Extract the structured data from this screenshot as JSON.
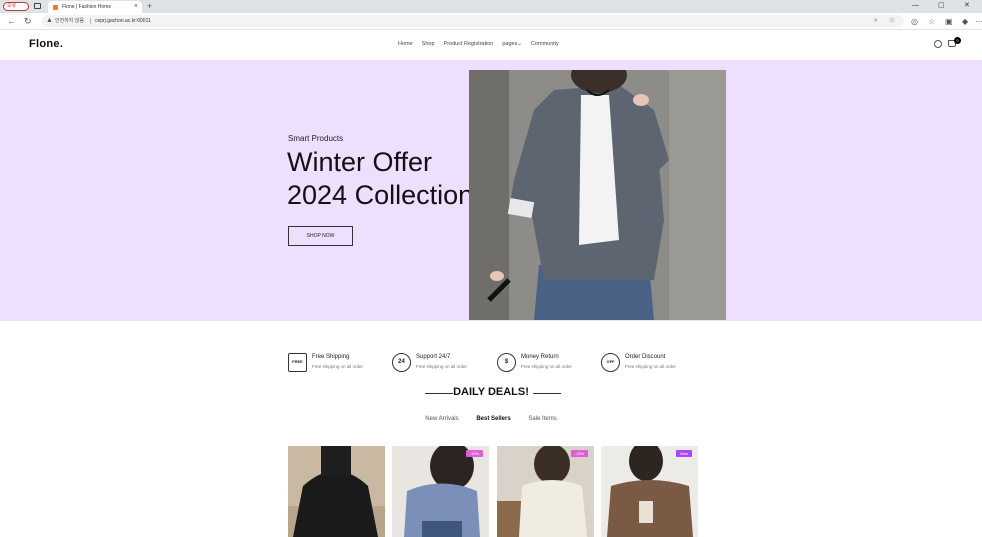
{
  "browser": {
    "profile_label": "오류",
    "tab_title": "Flone | Fashion Home",
    "tab_close": "×",
    "new_tab": "+",
    "security_warning": "안전하지 않음",
    "url": "ceprj.gachon.ac.kr:60011",
    "window_controls": [
      "—",
      "▢",
      "✕"
    ]
  },
  "site": {
    "logo": "Flone.",
    "nav": [
      "Home",
      "Shop",
      "Product Registration",
      "pages",
      "Community"
    ],
    "cart_count": "0"
  },
  "hero": {
    "subtitle": "Smart Products",
    "title_line1": "Winter Offer",
    "title_line2": "2024 Collection",
    "button_label": "SHOP NOW",
    "background_color": "#efdfff"
  },
  "features": [
    {
      "title": "Free Shipping",
      "desc": "Free shipping on all order",
      "icon": "truck-icon",
      "glyph": "FREE"
    },
    {
      "title": "Support 24/7",
      "desc": "Free shipping on all order",
      "icon": "support-24-icon",
      "glyph": "24"
    },
    {
      "title": "Money Return",
      "desc": "Free shipping on all order",
      "icon": "money-return-icon",
      "glyph": "$"
    },
    {
      "title": "Order Discount",
      "desc": "Free shipping on all order",
      "icon": "discount-icon",
      "glyph": "OFF"
    }
  ],
  "deals": {
    "title": "DAILY DEALS!",
    "tabs": [
      "New Arrivals",
      "Best Sellers",
      "Sale Items"
    ],
    "active_tab": "Best Sellers"
  },
  "products": [
    {
      "badge": ""
    },
    {
      "badge": "-10%"
    },
    {
      "badge": "-10%"
    },
    {
      "badge": "New"
    }
  ]
}
